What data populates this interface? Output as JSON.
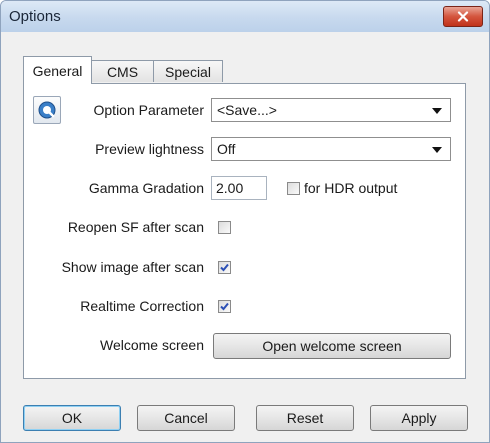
{
  "window": {
    "title": "Options"
  },
  "tabs": [
    {
      "label": "General",
      "active": true
    },
    {
      "label": "CMS",
      "active": false
    },
    {
      "label": "Special",
      "active": false
    }
  ],
  "general": {
    "option_parameter": {
      "label": "Option Parameter",
      "value": "<Save...>"
    },
    "preview_lightness": {
      "label": "Preview lightness",
      "value": "Off"
    },
    "gamma_gradation": {
      "label": "Gamma Gradation",
      "value": "2.00"
    },
    "hdr_output": {
      "label": "for HDR output",
      "checked": false
    },
    "reopen_sf": {
      "label": "Reopen SF after scan",
      "checked": false
    },
    "show_image": {
      "label": "Show image after scan",
      "checked": true
    },
    "realtime_correction": {
      "label": "Realtime Correction",
      "checked": true
    },
    "welcome_screen": {
      "label": "Welcome screen",
      "button_label": "Open welcome screen"
    }
  },
  "buttons": {
    "ok": "OK",
    "cancel": "Cancel",
    "reset": "Reset",
    "apply": "Apply"
  },
  "icons": {
    "close": "close-icon",
    "app": "silverfast-icon",
    "dropdown": "chevron-down-icon",
    "check": "checkmark-icon"
  },
  "colors": {
    "title_bar": "#c7d9ee",
    "close_button": "#c8412a",
    "check": "#2b4fb5"
  }
}
